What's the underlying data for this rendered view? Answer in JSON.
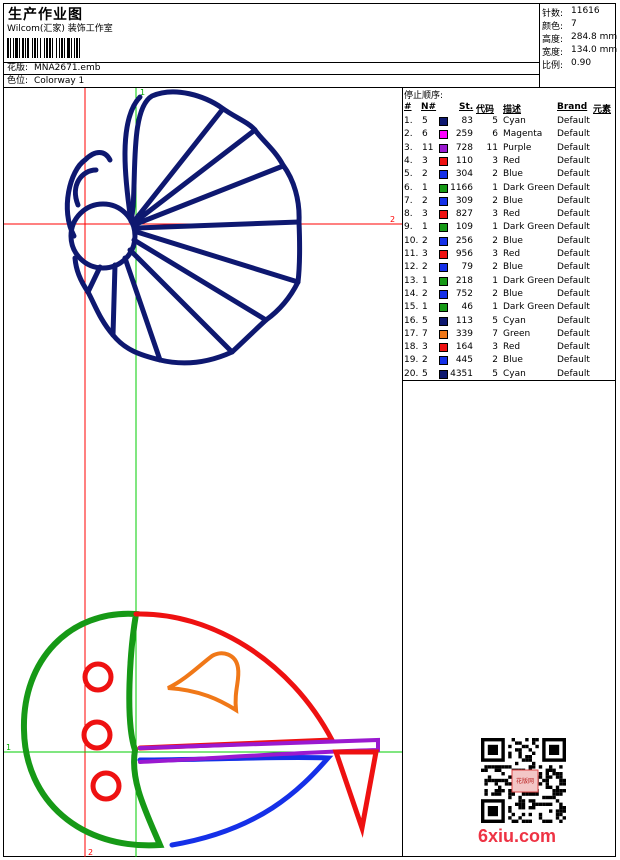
{
  "header": {
    "title": "生产作业图",
    "company": "Wilcom(汇家) 装饰工作室",
    "design_label": "花版:",
    "design_value": "MNA2671.emb",
    "colorway_label": "色位:",
    "colorway_value": "Colorway 1"
  },
  "stats": [
    {
      "label": "针数:",
      "value": "11616"
    },
    {
      "label": "颜色:",
      "value": "7"
    },
    {
      "label": "高度:",
      "value": "284.8 mm"
    },
    {
      "label": "宽度:",
      "value": "134.0 mm"
    },
    {
      "label": "比例:",
      "value": "0.90"
    }
  ],
  "stop_sequence": {
    "title": "停止顺序:",
    "headers": {
      "idx": "#",
      "n": "N#",
      "st": "St.",
      "code": "代码",
      "desc": "描述",
      "brand": "Brand",
      "element": "元素"
    },
    "rows": [
      {
        "idx": "1.",
        "n": "5",
        "color": "#0e1870",
        "st": "83",
        "code": "5",
        "desc": "Cyan",
        "brand": "Default"
      },
      {
        "idx": "2.",
        "n": "6",
        "color": "#ff00ff",
        "st": "259",
        "code": "6",
        "desc": "Magenta",
        "brand": "Default"
      },
      {
        "idx": "3.",
        "n": "11",
        "color": "#9a19d0",
        "st": "728",
        "code": "11",
        "desc": "Purple",
        "brand": "Default"
      },
      {
        "idx": "4.",
        "n": "3",
        "color": "#ee1111",
        "st": "110",
        "code": "3",
        "desc": "Red",
        "brand": "Default"
      },
      {
        "idx": "5.",
        "n": "2",
        "color": "#1530e8",
        "st": "304",
        "code": "2",
        "desc": "Blue",
        "brand": "Default"
      },
      {
        "idx": "6.",
        "n": "1",
        "color": "#169916",
        "st": "1166",
        "code": "1",
        "desc": "Dark Green",
        "brand": "Default"
      },
      {
        "idx": "7.",
        "n": "2",
        "color": "#1530e8",
        "st": "309",
        "code": "2",
        "desc": "Blue",
        "brand": "Default"
      },
      {
        "idx": "8.",
        "n": "3",
        "color": "#ee1111",
        "st": "827",
        "code": "3",
        "desc": "Red",
        "brand": "Default"
      },
      {
        "idx": "9.",
        "n": "1",
        "color": "#169916",
        "st": "109",
        "code": "1",
        "desc": "Dark Green",
        "brand": "Default"
      },
      {
        "idx": "10.",
        "n": "2",
        "color": "#1530e8",
        "st": "256",
        "code": "2",
        "desc": "Blue",
        "brand": "Default"
      },
      {
        "idx": "11.",
        "n": "3",
        "color": "#ee1111",
        "st": "956",
        "code": "3",
        "desc": "Red",
        "brand": "Default"
      },
      {
        "idx": "12.",
        "n": "2",
        "color": "#1530e8",
        "st": "79",
        "code": "2",
        "desc": "Blue",
        "brand": "Default"
      },
      {
        "idx": "13.",
        "n": "1",
        "color": "#169916",
        "st": "218",
        "code": "1",
        "desc": "Dark Green",
        "brand": "Default"
      },
      {
        "idx": "14.",
        "n": "2",
        "color": "#1530e8",
        "st": "752",
        "code": "2",
        "desc": "Blue",
        "brand": "Default"
      },
      {
        "idx": "15.",
        "n": "1",
        "color": "#169916",
        "st": "46",
        "code": "1",
        "desc": "Dark Green",
        "brand": "Default"
      },
      {
        "idx": "16.",
        "n": "5",
        "color": "#0e1870",
        "st": "113",
        "code": "5",
        "desc": "Cyan",
        "brand": "Default"
      },
      {
        "idx": "17.",
        "n": "7",
        "color": "#f07818",
        "st": "339",
        "code": "7",
        "desc": "Green",
        "brand": "Default"
      },
      {
        "idx": "18.",
        "n": "3",
        "color": "#ee1111",
        "st": "164",
        "code": "3",
        "desc": "Red",
        "brand": "Default"
      },
      {
        "idx": "19.",
        "n": "2",
        "color": "#1530e8",
        "st": "445",
        "code": "2",
        "desc": "Blue",
        "brand": "Default"
      },
      {
        "idx": "20.",
        "n": "5",
        "color": "#0e1870",
        "st": "4351",
        "code": "5",
        "desc": "Cyan",
        "brand": "Default"
      }
    ]
  },
  "design": {
    "axis_labels": {
      "top_1": "1",
      "right_2": "2",
      "left_1": "1",
      "bottom_2": "2"
    },
    "colors": {
      "navy": "#0e1870",
      "red": "#ee1111",
      "green": "#169916",
      "blue": "#1530e8",
      "purple": "#9a19d0",
      "orange": "#f07818",
      "guide_red": "#ff0000",
      "guide_green": "#00cc00"
    }
  },
  "watermark": {
    "text": "6xiu.com",
    "seal_text": "花版网"
  }
}
